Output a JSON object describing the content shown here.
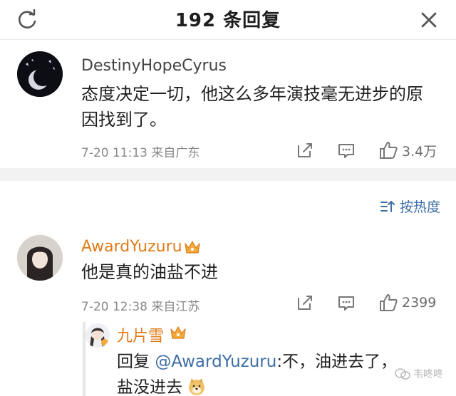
{
  "header": {
    "title": "192 条回复"
  },
  "comments": [
    {
      "username": "DestinyHopeCyrus",
      "content": "态度决定一切，他这么多年演技毫无进步的原因找到了。",
      "time_location": "7-20 11:13 来自广东",
      "likes": "3.4万"
    },
    {
      "username": "AwardYuzuru",
      "content": "他是真的油盐不进",
      "time_location": "7-20 12:38 来自江苏",
      "likes": "2399"
    }
  ],
  "sort": {
    "label": "按热度"
  },
  "reply": {
    "username": "九片雪",
    "prefix": "回复 ",
    "mention": "@AwardYuzuru",
    "text": ":不，油进去了，盐没进去",
    "emoji": "doge-emoji"
  },
  "watermark": {
    "text": "韦咚咚"
  },
  "colors": {
    "link_blue": "#3d6ea5",
    "vip_gold": "#e07b19",
    "meta_gray": "#8a8a8a"
  }
}
